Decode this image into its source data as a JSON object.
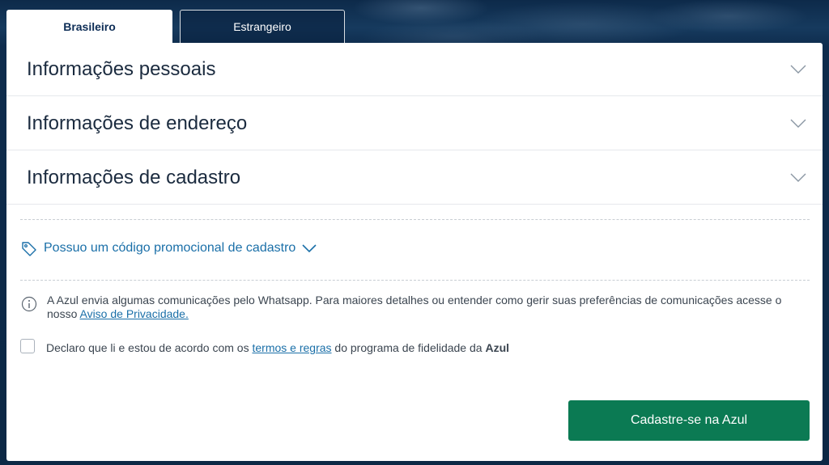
{
  "tabs": [
    {
      "label": "Brasileiro",
      "active": true
    },
    {
      "label": "Estrangeiro",
      "active": false
    }
  ],
  "accordion": [
    {
      "title": "Informações pessoais",
      "icon": "chevron-down-icon"
    },
    {
      "title": "Informações de endereço",
      "icon": "chevron-down-icon"
    },
    {
      "title": "Informações de cadastro",
      "icon": "chevron-down-icon"
    }
  ],
  "promo": {
    "label": "Possuo um código promocional de cadastro",
    "icon": "tag-icon"
  },
  "info": {
    "icon": "info-icon",
    "text": "A Azul envia algumas comunicações pelo Whatsapp. Para maiores detalhes ou entender como gerir suas preferências de comunicações acesse o nosso ",
    "link": "Aviso de Privacidade."
  },
  "agreement": {
    "checked": false,
    "prefix": "Declaro que li e estou de acordo com os ",
    "link": "termos e regras",
    "middle": " do programa de fidelidade da ",
    "brand": "Azul"
  },
  "submit_label": "Cadastre-se na Azul",
  "colors": {
    "primary": "#0d2d56",
    "link": "#1a6fa8",
    "button": "#0b7a53"
  }
}
